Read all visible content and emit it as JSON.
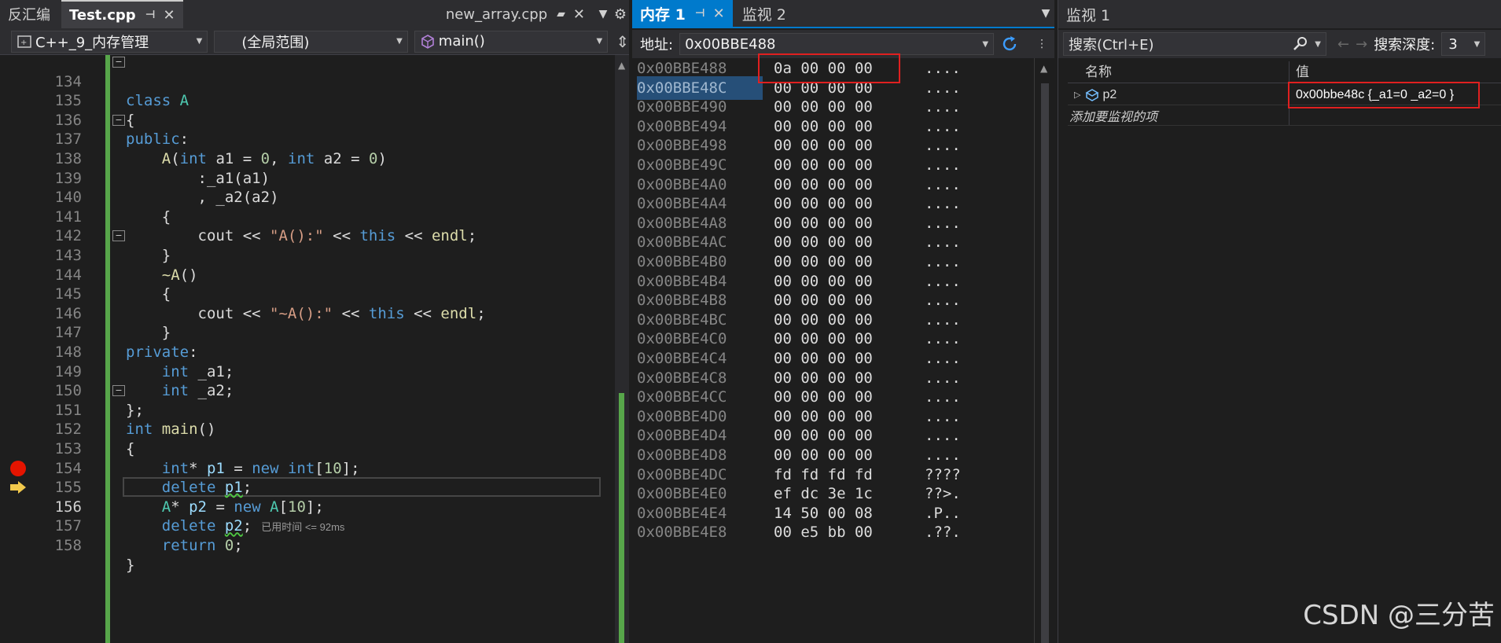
{
  "editor": {
    "tabs": [
      {
        "label": "反汇编"
      },
      {
        "label": "Test.cpp"
      },
      {
        "label": "new_array.cpp"
      }
    ],
    "nav": {
      "project": "C++_9_内存管理",
      "scope": "(全局范围)",
      "function": "main()"
    },
    "elapsed": "已用时间 <= 92ms",
    "line_numbers": [
      "134",
      "135",
      "136",
      "137",
      "138",
      "139",
      "140",
      "141",
      "142",
      "143",
      "144",
      "145",
      "146",
      "147",
      "148",
      "149",
      "150",
      "151",
      "152",
      "153",
      "154",
      "155",
      "156",
      "157",
      "158"
    ]
  },
  "memory": {
    "tabs": [
      {
        "label": "内存 1"
      },
      {
        "label": "监视 2"
      }
    ],
    "address_label": "地址:",
    "address_value": "0x00BBE488",
    "rows": [
      {
        "addr": "0x00BBE488",
        "bytes": "0a 00 00 00",
        "ascii": "...."
      },
      {
        "addr": "0x00BBE48C",
        "bytes": "00 00 00 00",
        "ascii": "...."
      },
      {
        "addr": "0x00BBE490",
        "bytes": "00 00 00 00",
        "ascii": "...."
      },
      {
        "addr": "0x00BBE494",
        "bytes": "00 00 00 00",
        "ascii": "...."
      },
      {
        "addr": "0x00BBE498",
        "bytes": "00 00 00 00",
        "ascii": "...."
      },
      {
        "addr": "0x00BBE49C",
        "bytes": "00 00 00 00",
        "ascii": "...."
      },
      {
        "addr": "0x00BBE4A0",
        "bytes": "00 00 00 00",
        "ascii": "...."
      },
      {
        "addr": "0x00BBE4A4",
        "bytes": "00 00 00 00",
        "ascii": "...."
      },
      {
        "addr": "0x00BBE4A8",
        "bytes": "00 00 00 00",
        "ascii": "...."
      },
      {
        "addr": "0x00BBE4AC",
        "bytes": "00 00 00 00",
        "ascii": "...."
      },
      {
        "addr": "0x00BBE4B0",
        "bytes": "00 00 00 00",
        "ascii": "...."
      },
      {
        "addr": "0x00BBE4B4",
        "bytes": "00 00 00 00",
        "ascii": "...."
      },
      {
        "addr": "0x00BBE4B8",
        "bytes": "00 00 00 00",
        "ascii": "...."
      },
      {
        "addr": "0x00BBE4BC",
        "bytes": "00 00 00 00",
        "ascii": "...."
      },
      {
        "addr": "0x00BBE4C0",
        "bytes": "00 00 00 00",
        "ascii": "...."
      },
      {
        "addr": "0x00BBE4C4",
        "bytes": "00 00 00 00",
        "ascii": "...."
      },
      {
        "addr": "0x00BBE4C8",
        "bytes": "00 00 00 00",
        "ascii": "...."
      },
      {
        "addr": "0x00BBE4CC",
        "bytes": "00 00 00 00",
        "ascii": "...."
      },
      {
        "addr": "0x00BBE4D0",
        "bytes": "00 00 00 00",
        "ascii": "...."
      },
      {
        "addr": "0x00BBE4D4",
        "bytes": "00 00 00 00",
        "ascii": "...."
      },
      {
        "addr": "0x00BBE4D8",
        "bytes": "00 00 00 00",
        "ascii": "...."
      },
      {
        "addr": "0x00BBE4DC",
        "bytes": "fd fd fd fd",
        "ascii": "????"
      },
      {
        "addr": "0x00BBE4E0",
        "bytes": "ef dc 3e 1c",
        "ascii": "??>."
      },
      {
        "addr": "0x00BBE4E4",
        "bytes": "14 50 00 08",
        "ascii": ".P.."
      },
      {
        "addr": "0x00BBE4E8",
        "bytes": "00 e5 bb 00",
        "ascii": ".??."
      }
    ]
  },
  "watch": {
    "title": "监视 1",
    "search_placeholder": "搜索(Ctrl+E)",
    "depth_label": "搜索深度:",
    "depth_value": "3",
    "col_name": "名称",
    "col_value": "值",
    "items": [
      {
        "name": "p2",
        "value": "0x00bbe48c {_a1=0 _a2=0 }"
      }
    ],
    "add_prompt": "添加要监视的项"
  },
  "watermark": "CSDN @三分苦",
  "colors": {
    "breakpoint": "#e51400",
    "instruction_pointer": "#f2c94c",
    "change_bar": "#57a64a",
    "highlight_box": "#e02020",
    "memory_tab_active": "#007acc"
  }
}
